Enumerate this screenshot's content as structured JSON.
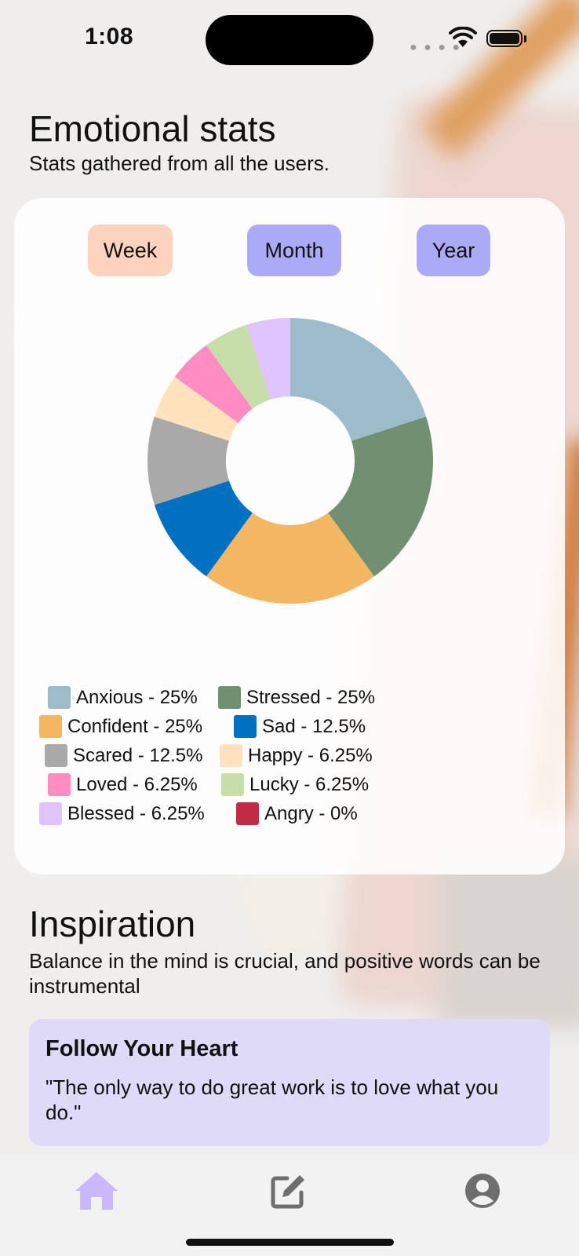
{
  "status_bar": {
    "time": "1:08",
    "signal_icon": "signal-dots-icon",
    "wifi_icon": "wifi-icon",
    "battery_icon": "battery-icon"
  },
  "header": {
    "title": "Emotional stats",
    "subtitle": "Stats gathered from all the users."
  },
  "period_tabs": [
    {
      "label": "Week",
      "color": "#fdd3be",
      "selected": true
    },
    {
      "label": "Month",
      "color": "#aaaaf7",
      "selected": false
    },
    {
      "label": "Year",
      "color": "#aaaaf7",
      "selected": false
    }
  ],
  "chart_data": {
    "type": "pie",
    "style": "donut",
    "slices": [
      {
        "label": "Anxious",
        "value": 25,
        "color": "#9bbcc8"
      },
      {
        "label": "Stressed",
        "value": 25,
        "color": "#718f71"
      },
      {
        "label": "Confident",
        "value": 25,
        "color": "#f3b762"
      },
      {
        "label": "Sad",
        "value": 12.5,
        "color": "#0070c0"
      },
      {
        "label": "Scared",
        "value": 12.5,
        "color": "#a9a9a9"
      },
      {
        "label": "Happy",
        "value": 6.25,
        "color": "#ffe3bd"
      },
      {
        "label": "Loved",
        "value": 6.25,
        "color": "#ff8dc2"
      },
      {
        "label": "Lucky",
        "value": 6.25,
        "color": "#c7dea8"
      },
      {
        "label": "Blessed",
        "value": 6.25,
        "color": "#dec3ff"
      },
      {
        "label": "Angry",
        "value": 0,
        "color": "#c12c44"
      }
    ]
  },
  "legend": [
    {
      "text": "Anxious - 25%",
      "color": "#9bbcc8"
    },
    {
      "text": "Stressed - 25%",
      "color": "#718f71"
    },
    {
      "text": "Confident - 25%",
      "color": "#f3b762"
    },
    {
      "text": "Sad - 12.5%",
      "color": "#0070c0"
    },
    {
      "text": "Scared - 12.5%",
      "color": "#a9a9a9"
    },
    {
      "text": "Happy - 6.25%",
      "color": "#ffe3bd"
    },
    {
      "text": "Loved - 6.25%",
      "color": "#ff8dc2"
    },
    {
      "text": "Lucky - 6.25%",
      "color": "#c7dea8"
    },
    {
      "text": "Blessed - 6.25%",
      "color": "#dec3ff"
    },
    {
      "text": "Angry - 0%",
      "color": "#c12c44"
    }
  ],
  "inspiration": {
    "title": "Inspiration",
    "description": "Balance in the mind is crucial, and positive words can be instrumental",
    "quote_title": "Follow Your Heart",
    "quote_text": "\"The only way to do great work is to love what you do.\""
  },
  "tab_bar": {
    "items": [
      {
        "icon": "home-icon",
        "active": true,
        "color": "#c9b8fb"
      },
      {
        "icon": "edit-icon",
        "active": false,
        "color": "#6e6e6e"
      },
      {
        "icon": "profile-icon",
        "active": false,
        "color": "#6e6e6e"
      }
    ]
  }
}
